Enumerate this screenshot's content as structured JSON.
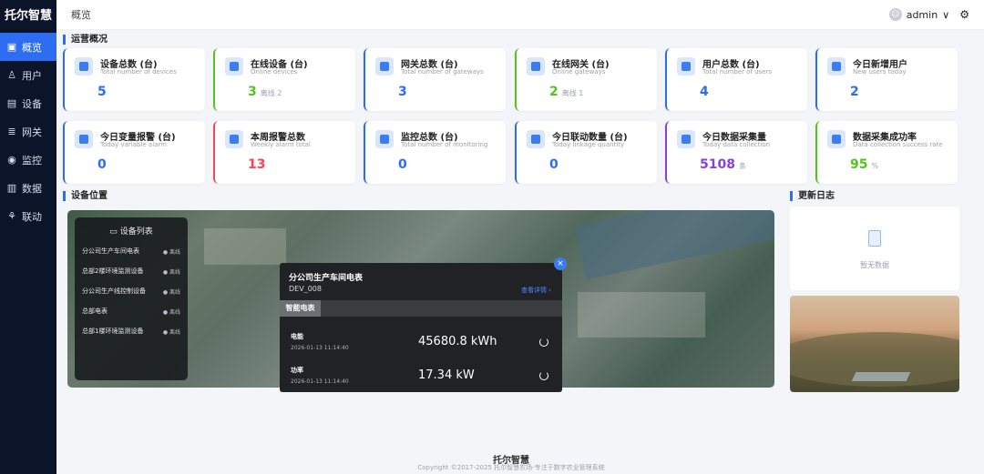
{
  "sidebar": {
    "logo": "托尔智慧",
    "items": [
      {
        "label": "概览",
        "icon": "▣"
      },
      {
        "label": "用户",
        "icon": "♙"
      },
      {
        "label": "设备",
        "icon": "▤"
      },
      {
        "label": "网关",
        "icon": "≣"
      },
      {
        "label": "监控",
        "icon": "◉"
      },
      {
        "label": "数据",
        "icon": "▥"
      },
      {
        "label": "联动",
        "icon": "⚘"
      }
    ]
  },
  "topbar": {
    "breadcrumb": "概览",
    "username": "admin",
    "caret": "∨",
    "avatar": "☺"
  },
  "sections": {
    "ops": "运营概况",
    "location": "设备位置",
    "log": "更新日志"
  },
  "stats": [
    {
      "title": "设备总数 (台)",
      "subtitle": "Total number of devices",
      "value": "5",
      "extra": "",
      "color": "#2c6df2"
    },
    {
      "title": "在线设备 (台)",
      "subtitle": "Online devices",
      "value": "3",
      "extra": "离线 2",
      "color": "#52c41a"
    },
    {
      "title": "网关总数 (台)",
      "subtitle": "Total number of gateways",
      "value": "3",
      "extra": "",
      "color": "#2c6df2"
    },
    {
      "title": "在线网关 (台)",
      "subtitle": "Online gateways",
      "value": "2",
      "extra": "离线 1",
      "color": "#52c41a"
    },
    {
      "title": "用户总数 (台)",
      "subtitle": "Total number of users",
      "value": "4",
      "extra": "",
      "color": "#2c6df2"
    },
    {
      "title": "今日新增用户",
      "subtitle": "New users today",
      "value": "2",
      "extra": "",
      "color": "#2c6df2"
    },
    {
      "title": "今日变量报警 (台)",
      "subtitle": "Today variable alarm",
      "value": "0",
      "extra": "",
      "color": "#2c6df2"
    },
    {
      "title": "本周报警总数",
      "subtitle": "Weekly alarm total",
      "value": "13",
      "extra": "",
      "color": "#f5455c"
    },
    {
      "title": "监控总数 (台)",
      "subtitle": "Total number of monitoring",
      "value": "0",
      "extra": "",
      "color": "#2c6df2"
    },
    {
      "title": "今日联动数量 (台)",
      "subtitle": "Today linkage quantity",
      "value": "0",
      "extra": "",
      "color": "#2c6df2"
    },
    {
      "title": "今日数据采集量",
      "subtitle": "Today data collection",
      "value": "5108",
      "extra": "条",
      "color": "#8b3fd9"
    },
    {
      "title": "数据采集成功率",
      "subtitle": "Data collection success rate",
      "value": "95",
      "extra": "%",
      "color": "#52c41a"
    }
  ],
  "device_list": {
    "header": "设备列表",
    "header_icon": "▭",
    "items": [
      {
        "name": "分公司生产车间电表",
        "status": "● 离线"
      },
      {
        "name": "总部2楼环境监测设备",
        "status": "● 离线"
      },
      {
        "name": "分公司生产线控制设备",
        "status": "● 离线"
      },
      {
        "name": "总部电表",
        "status": "● 离线"
      },
      {
        "name": "总部1楼环境监测设备",
        "status": "● 离线"
      }
    ]
  },
  "popup": {
    "title": "分公司生产车间电表",
    "device_id": "DEV_008",
    "detail_link": "查看详情 ›",
    "tab": "智能电表",
    "close": "×",
    "metrics": [
      {
        "name": "电能",
        "time": "2026-01-13 11:14:40",
        "value": "45680.8 kWh"
      },
      {
        "name": "功率",
        "time": "2026-01-13 11:14:40",
        "value": "17.34 kW"
      }
    ]
  },
  "log": {
    "empty_text": "暂无数据"
  },
  "footer": {
    "brand": "托尔智慧",
    "copyright": "Copyright ©2017-2025 托尔智慧农场-专注于数字农业管理系统"
  }
}
